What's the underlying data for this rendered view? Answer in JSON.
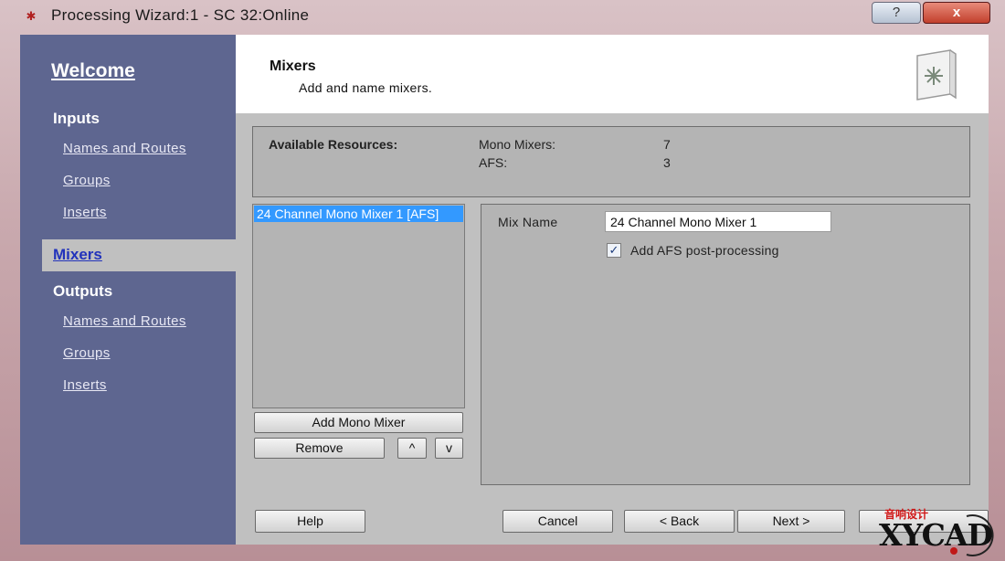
{
  "window": {
    "title": "Processing Wizard:1 - SC 32:Online",
    "help_label": "?",
    "close_label": "x"
  },
  "sidebar": {
    "welcome": "Welcome",
    "inputs_heading": "Inputs",
    "inputs_links": [
      "Names and Routes",
      "Groups",
      "Inserts"
    ],
    "active": "Mixers",
    "outputs_heading": "Outputs",
    "outputs_links": [
      "Names and Routes",
      "Groups",
      "Inserts"
    ]
  },
  "header": {
    "title": "Mixers",
    "subtitle": "Add and name mixers.",
    "icon": "wizard-page-icon"
  },
  "resources": {
    "label": "Available Resources:",
    "items": [
      {
        "key": "Mono Mixers:",
        "value": "7"
      },
      {
        "key": "AFS:",
        "value": "3"
      }
    ]
  },
  "mixer_list": {
    "items": [
      "24 Channel Mono Mixer 1 [AFS]"
    ],
    "selected_index": 0
  },
  "buttons": {
    "add_mono_mixer": "Add Mono Mixer",
    "remove": "Remove",
    "move_up": "^",
    "move_down": "v",
    "help": "Help",
    "cancel": "Cancel",
    "back": "< Back",
    "next": "Next >"
  },
  "mix_panel": {
    "mix_name_label": "Mix Name",
    "mix_name_value": "24 Channel Mono Mixer 1",
    "afs_label": "Add AFS post-processing",
    "afs_checked": true,
    "check_glyph": "✓"
  },
  "watermark": {
    "line1": "音响设计",
    "line2": "XYCAD"
  },
  "colors": {
    "sidebar": "#5e6690",
    "selection": "#3399ff",
    "active_link": "#2233bb"
  }
}
